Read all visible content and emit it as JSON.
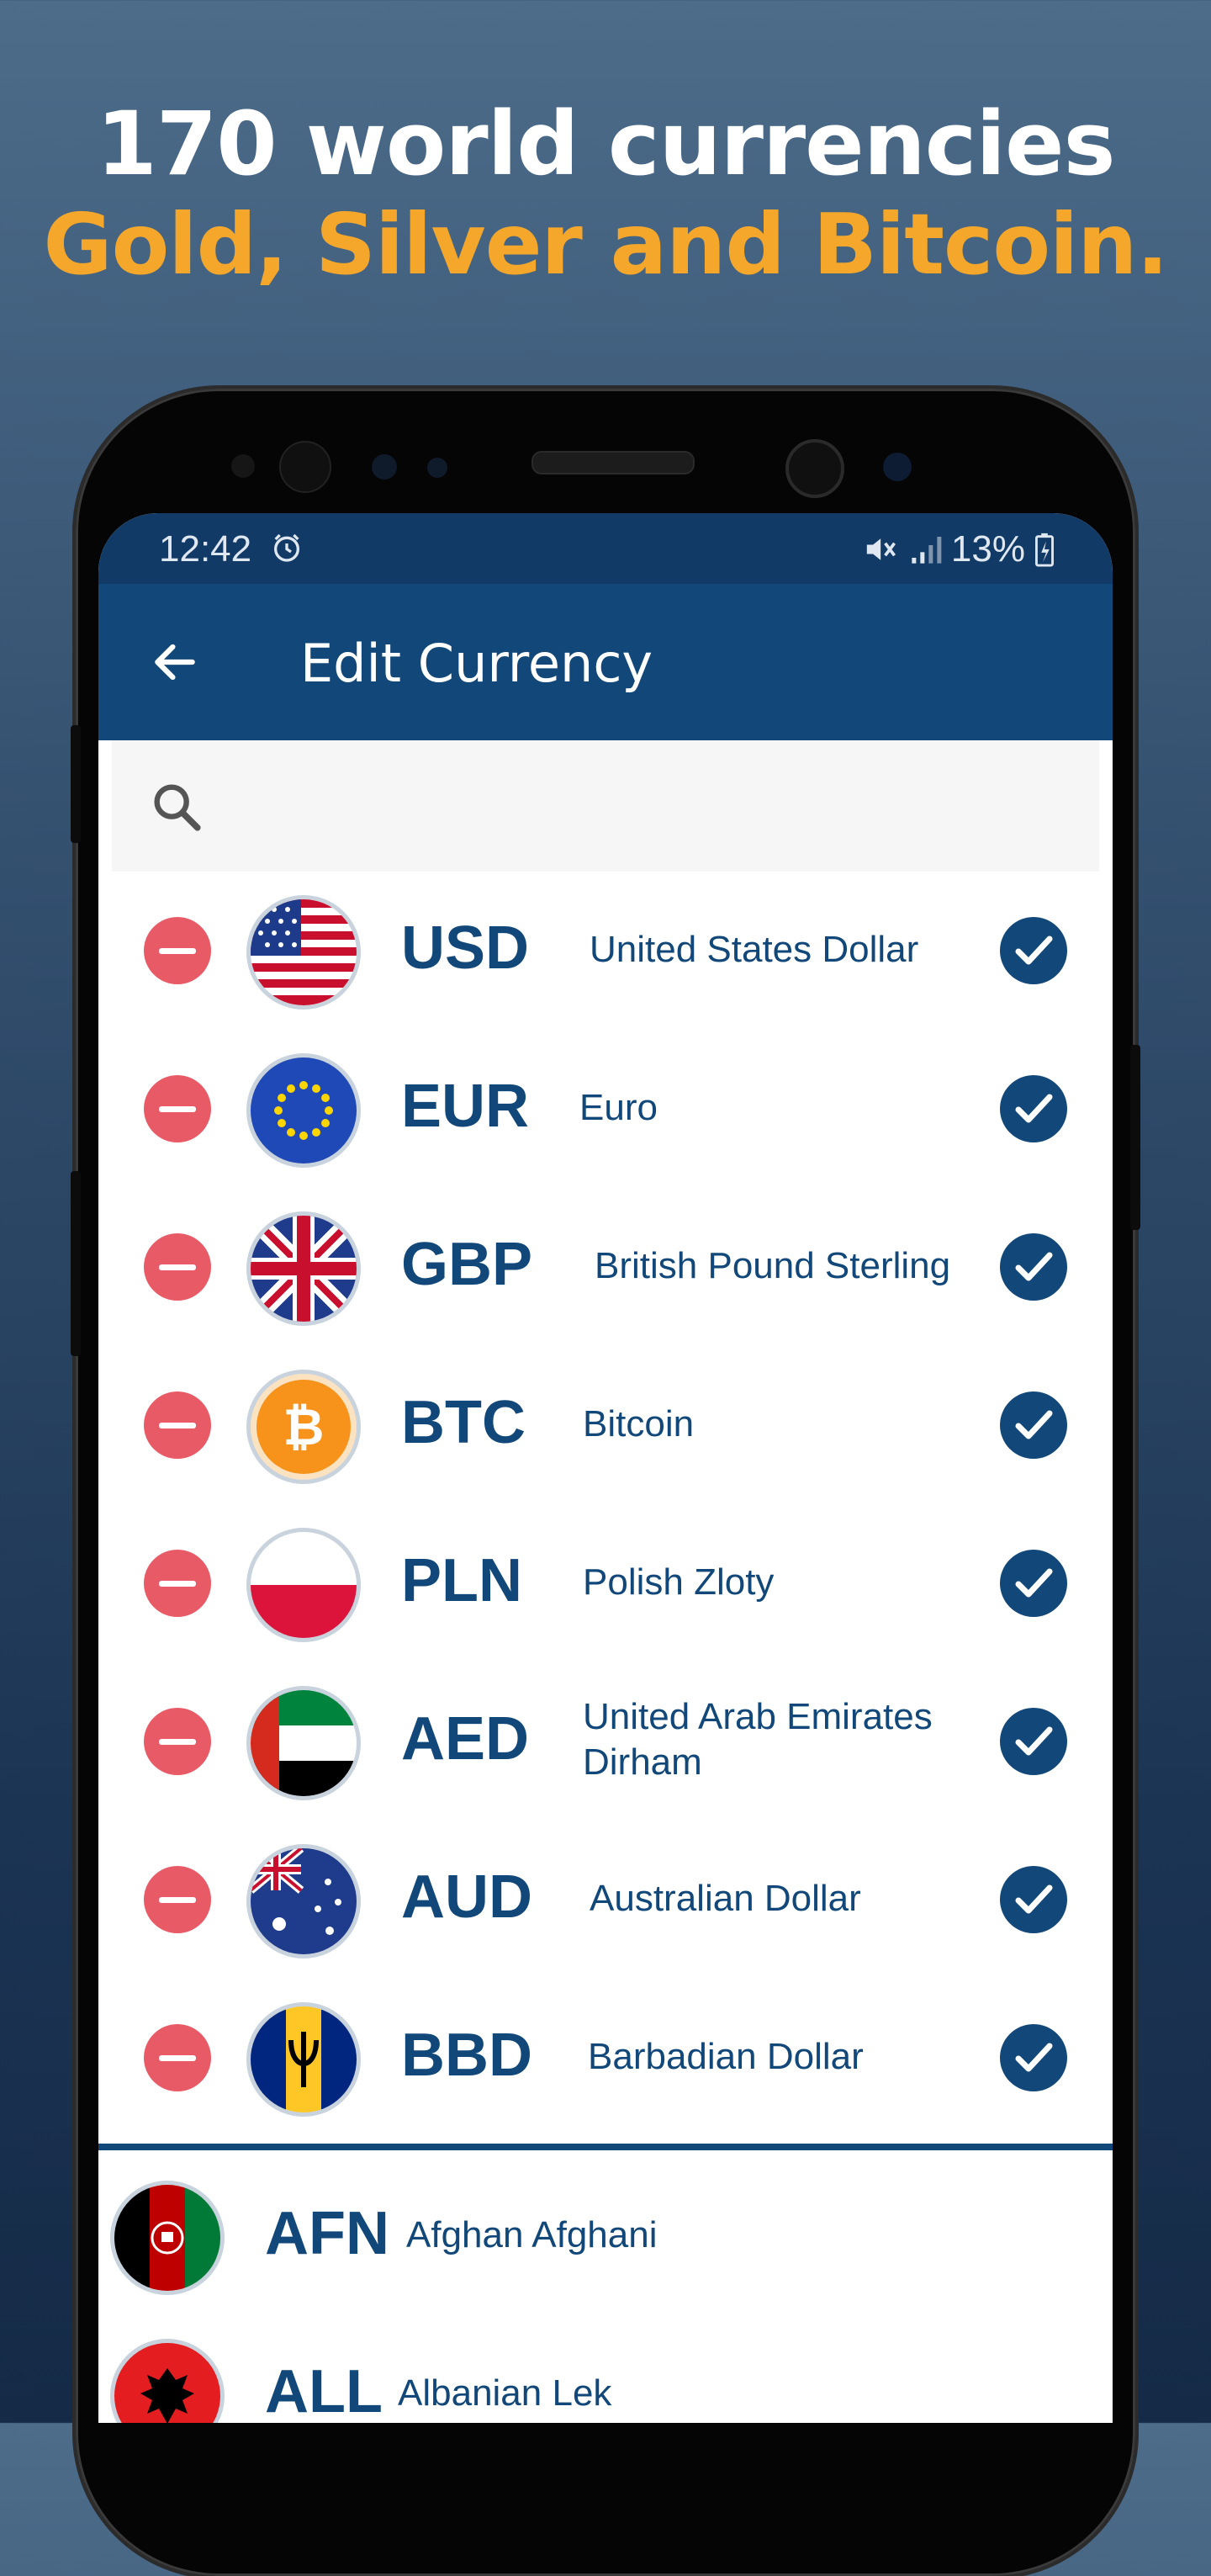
{
  "promo": {
    "line1": "170 world currencies",
    "line2": "Gold, Silver and Bitcoin."
  },
  "status_bar": {
    "time": "12:42",
    "battery": "13%",
    "icons": [
      "alarm-icon",
      "mute-icon",
      "signal-icon",
      "battery-charging-icon"
    ]
  },
  "app_bar": {
    "title": "Edit Currency",
    "back_icon": "arrow-back-icon"
  },
  "search": {
    "icon": "search-icon",
    "value": ""
  },
  "selected_currencies": [
    {
      "code": "USD",
      "name": "United States Dollar",
      "flag": "us-flag",
      "checked": true
    },
    {
      "code": "EUR",
      "name": "Euro",
      "flag": "eu-flag",
      "checked": true
    },
    {
      "code": "GBP",
      "name": "British Pound Sterling",
      "flag": "uk-flag",
      "checked": true
    },
    {
      "code": "BTC",
      "name": "Bitcoin",
      "flag": "bitcoin-logo",
      "checked": true
    },
    {
      "code": "PLN",
      "name": "Polish Zloty",
      "flag": "poland-flag",
      "checked": true
    },
    {
      "code": "AED",
      "name": "United Arab Emirates Dirham",
      "flag": "uae-flag",
      "checked": true
    },
    {
      "code": "AUD",
      "name": "Australian Dollar",
      "flag": "australia-flag",
      "checked": true
    },
    {
      "code": "BBD",
      "name": "Barbadian Dollar",
      "flag": "barbados-flag",
      "checked": true
    }
  ],
  "other_currencies": [
    {
      "code": "AFN",
      "name": "Afghan Afghani",
      "flag": "afghanistan-flag"
    },
    {
      "code": "ALL",
      "name": "Albanian Lek",
      "flag": "albania-flag"
    }
  ],
  "colors": {
    "primary": "#124879",
    "remove": "#e85a66",
    "accent_text": "#f4a72b"
  }
}
